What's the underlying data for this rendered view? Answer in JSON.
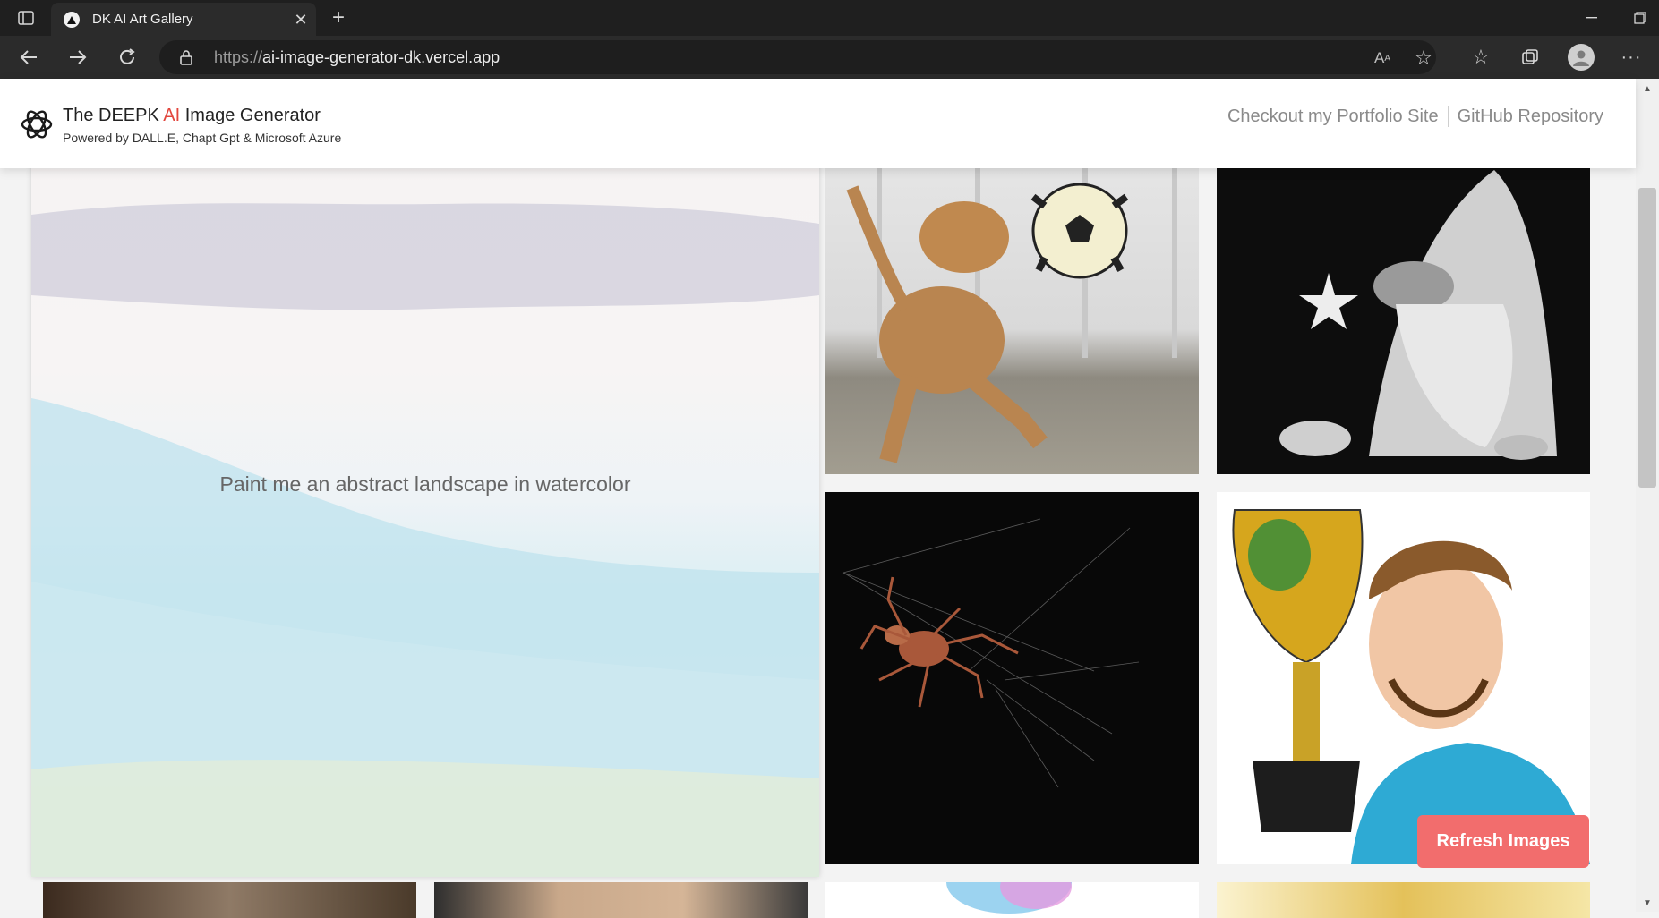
{
  "browser": {
    "tab_title": "DK AI Art Gallery",
    "url_scheme": "https://",
    "url_host": "ai-image-generator-dk.vercel.app"
  },
  "header": {
    "title_prefix": "The DEEPK ",
    "title_accent": "AI",
    "title_suffix": " Image Generator",
    "subtitle": "Powered by DALL.E, Chapt Gpt & Microsoft Azure",
    "accent_color": "#e2453c",
    "nav": [
      "Checkout my Portfolio Site",
      "GitHub Repository"
    ]
  },
  "gallery": {
    "featured_prompt": "Paint me an abstract landscape in watercolor",
    "tiles": [
      {
        "subject": "dog playing with soccer ball"
      },
      {
        "subject": "black and white gnome sculpture"
      },
      {
        "subject": "spider on web at night"
      },
      {
        "subject": "cartoon footballer holding trophy"
      }
    ]
  },
  "actions": {
    "refresh_label": "Refresh Images",
    "refresh_color": "#f26d6d"
  }
}
